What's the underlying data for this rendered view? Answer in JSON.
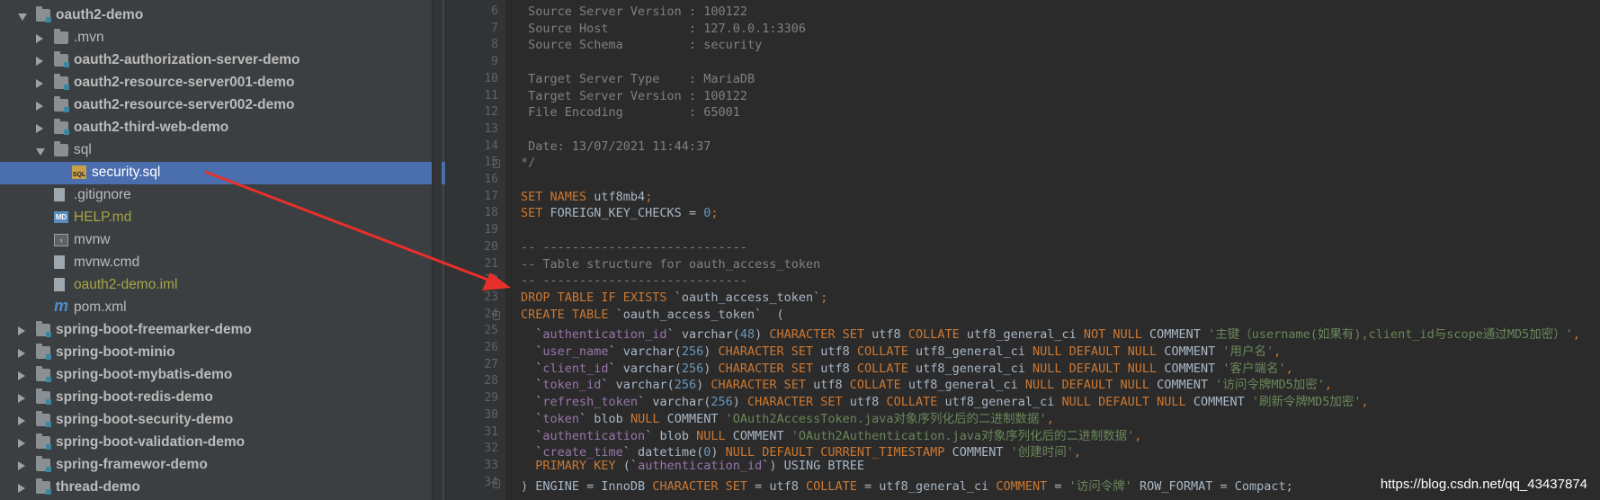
{
  "tree": {
    "items": [
      {
        "label": "oauth2-demo",
        "icon": "module-folder-icon",
        "arrow": "down",
        "bold": true,
        "indent": 0
      },
      {
        "label": ".mvn",
        "icon": "folder-icon",
        "arrow": "right",
        "bold": false,
        "indent": 1
      },
      {
        "label": "oauth2-authorization-server-demo",
        "icon": "module-folder-icon",
        "arrow": "right",
        "bold": true,
        "indent": 1
      },
      {
        "label": "oauth2-resource-server001-demo",
        "icon": "module-folder-icon",
        "arrow": "right",
        "bold": true,
        "indent": 1
      },
      {
        "label": "oauth2-resource-server002-demo",
        "icon": "module-folder-icon",
        "arrow": "right",
        "bold": true,
        "indent": 1
      },
      {
        "label": "oauth2-third-web-demo",
        "icon": "module-folder-icon",
        "arrow": "right",
        "bold": true,
        "indent": 1
      },
      {
        "label": "sql",
        "icon": "folder-icon",
        "arrow": "down",
        "bold": false,
        "indent": 1
      },
      {
        "label": "security.sql",
        "icon": "sql-file-icon",
        "arrow": "",
        "bold": false,
        "indent": 2,
        "selected": true
      },
      {
        "label": ".gitignore",
        "icon": "file-icon",
        "arrow": "",
        "bold": false,
        "indent": 1
      },
      {
        "label": "HELP.md",
        "icon": "markdown-file-icon",
        "arrow": "",
        "bold": false,
        "indent": 1,
        "color": "#a7a546"
      },
      {
        "label": "mvnw",
        "icon": "terminal-file-icon",
        "arrow": "",
        "bold": false,
        "indent": 1
      },
      {
        "label": "mvnw.cmd",
        "icon": "file-icon",
        "arrow": "",
        "bold": false,
        "indent": 1
      },
      {
        "label": "oauth2-demo.iml",
        "icon": "file-icon",
        "arrow": "",
        "bold": false,
        "indent": 1,
        "color": "#a7a546"
      },
      {
        "label": "pom.xml",
        "icon": "maven-icon",
        "arrow": "",
        "bold": false,
        "indent": 1
      },
      {
        "label": "spring-boot-freemarker-demo",
        "icon": "module-folder-icon",
        "arrow": "right",
        "bold": true,
        "indent": 0
      },
      {
        "label": "spring-boot-minio",
        "icon": "module-folder-icon",
        "arrow": "right",
        "bold": true,
        "indent": 0
      },
      {
        "label": "spring-boot-mybatis-demo",
        "icon": "module-folder-icon",
        "arrow": "right",
        "bold": true,
        "indent": 0
      },
      {
        "label": "spring-boot-redis-demo",
        "icon": "module-folder-icon",
        "arrow": "right",
        "bold": true,
        "indent": 0
      },
      {
        "label": "spring-boot-security-demo",
        "icon": "module-folder-icon",
        "arrow": "right",
        "bold": true,
        "indent": 0
      },
      {
        "label": "spring-boot-validation-demo",
        "icon": "module-folder-icon",
        "arrow": "right",
        "bold": true,
        "indent": 0
      },
      {
        "label": "spring-framewor-demo",
        "icon": "module-folder-icon",
        "arrow": "right",
        "bold": true,
        "indent": 0
      },
      {
        "label": "thread-demo",
        "icon": "module-folder-icon",
        "arrow": "right",
        "bold": true,
        "indent": 0
      }
    ]
  },
  "editor": {
    "lines": [
      {
        "n": "6",
        "parts": [
          [
            "cm",
            " Source Server Version : 100122"
          ]
        ]
      },
      {
        "n": "7",
        "parts": [
          [
            "cm",
            " Source Host           : 127.0.0.1:3306"
          ]
        ]
      },
      {
        "n": "8",
        "parts": [
          [
            "cm",
            " Source Schema         : security"
          ]
        ]
      },
      {
        "n": "9",
        "parts": []
      },
      {
        "n": "10",
        "parts": [
          [
            "cm",
            " Target Server Type    : MariaDB"
          ]
        ]
      },
      {
        "n": "11",
        "parts": [
          [
            "cm",
            " Target Server Version : 100122"
          ]
        ]
      },
      {
        "n": "12",
        "parts": [
          [
            "cm",
            " File Encoding         : 65001"
          ]
        ]
      },
      {
        "n": "13",
        "parts": []
      },
      {
        "n": "14",
        "parts": [
          [
            "cm",
            " Date: 13/07/2021 11:44:37"
          ]
        ]
      },
      {
        "n": "15",
        "parts": [
          [
            "cm",
            "*/"
          ]
        ],
        "fold": true
      },
      {
        "n": "16",
        "parts": []
      },
      {
        "n": "17",
        "parts": [
          [
            "kw",
            "SET NAMES "
          ],
          [
            "df",
            "utf8mb4"
          ],
          [
            "kw",
            ";"
          ]
        ]
      },
      {
        "n": "18",
        "parts": [
          [
            "kw",
            "SET "
          ],
          [
            "df",
            "FOREIGN_KEY_CHECKS = "
          ],
          [
            "nu",
            "0"
          ],
          [
            "kw",
            ";"
          ]
        ]
      },
      {
        "n": "19",
        "parts": []
      },
      {
        "n": "20",
        "parts": [
          [
            "cm",
            "-- ----------------------------"
          ]
        ]
      },
      {
        "n": "21",
        "parts": [
          [
            "cm",
            "-- Table structure for oauth_access_token"
          ]
        ]
      },
      {
        "n": "22",
        "parts": [
          [
            "cm",
            "-- ----------------------------"
          ]
        ]
      },
      {
        "n": "23",
        "parts": [
          [
            "kw",
            "DROP TABLE IF EXISTS "
          ],
          [
            "df",
            "`oauth_access_token`"
          ],
          [
            "kw",
            ";"
          ]
        ]
      },
      {
        "n": "24",
        "parts": [
          [
            "kw",
            "CREATE TABLE "
          ],
          [
            "df",
            "`oauth_access_token`  ("
          ]
        ],
        "fold": true
      },
      {
        "n": "25",
        "parts": [
          [
            "df",
            "  `"
          ],
          [
            "id",
            "authentication_id"
          ],
          [
            "df",
            "` varchar("
          ],
          [
            "nu",
            "48"
          ],
          [
            "df",
            ") "
          ],
          [
            "kw",
            "CHARACTER SET "
          ],
          [
            "df",
            "utf8 "
          ],
          [
            "kw",
            "COLLATE "
          ],
          [
            "df",
            "utf8_general_ci "
          ],
          [
            "kw",
            "NOT NULL "
          ],
          [
            "df",
            "COMMENT "
          ],
          [
            "st",
            "'主键（username(如果有),client_id与scope通过MD5加密）'"
          ],
          [
            "kw",
            ","
          ]
        ]
      },
      {
        "n": "26",
        "parts": [
          [
            "df",
            "  `"
          ],
          [
            "id",
            "user_name"
          ],
          [
            "df",
            "` varchar("
          ],
          [
            "nu",
            "256"
          ],
          [
            "df",
            ") "
          ],
          [
            "kw",
            "CHARACTER SET "
          ],
          [
            "df",
            "utf8 "
          ],
          [
            "kw",
            "COLLATE "
          ],
          [
            "df",
            "utf8_general_ci "
          ],
          [
            "kw",
            "NULL DEFAULT NULL "
          ],
          [
            "df",
            "COMMENT "
          ],
          [
            "st",
            "'用户名'"
          ],
          [
            "kw",
            ","
          ]
        ]
      },
      {
        "n": "27",
        "parts": [
          [
            "df",
            "  `"
          ],
          [
            "id",
            "client_id"
          ],
          [
            "df",
            "` varchar("
          ],
          [
            "nu",
            "256"
          ],
          [
            "df",
            ") "
          ],
          [
            "kw",
            "CHARACTER SET "
          ],
          [
            "df",
            "utf8 "
          ],
          [
            "kw",
            "COLLATE "
          ],
          [
            "df",
            "utf8_general_ci "
          ],
          [
            "kw",
            "NULL DEFAULT NULL "
          ],
          [
            "df",
            "COMMENT "
          ],
          [
            "st",
            "'客户端名'"
          ],
          [
            "kw",
            ","
          ]
        ]
      },
      {
        "n": "28",
        "parts": [
          [
            "df",
            "  `"
          ],
          [
            "id",
            "token_id"
          ],
          [
            "df",
            "` varchar("
          ],
          [
            "nu",
            "256"
          ],
          [
            "df",
            ") "
          ],
          [
            "kw",
            "CHARACTER SET "
          ],
          [
            "df",
            "utf8 "
          ],
          [
            "kw",
            "COLLATE "
          ],
          [
            "df",
            "utf8_general_ci "
          ],
          [
            "kw",
            "NULL DEFAULT NULL "
          ],
          [
            "df",
            "COMMENT "
          ],
          [
            "st",
            "'访问令牌MD5加密'"
          ],
          [
            "kw",
            ","
          ]
        ]
      },
      {
        "n": "29",
        "parts": [
          [
            "df",
            "  `"
          ],
          [
            "id",
            "refresh_token"
          ],
          [
            "df",
            "` varchar("
          ],
          [
            "nu",
            "256"
          ],
          [
            "df",
            ") "
          ],
          [
            "kw",
            "CHARACTER SET "
          ],
          [
            "df",
            "utf8 "
          ],
          [
            "kw",
            "COLLATE "
          ],
          [
            "df",
            "utf8_general_ci "
          ],
          [
            "kw",
            "NULL DEFAULT NULL "
          ],
          [
            "df",
            "COMMENT "
          ],
          [
            "st",
            "'刷新令牌MD5加密'"
          ],
          [
            "kw",
            ","
          ]
        ]
      },
      {
        "n": "30",
        "parts": [
          [
            "df",
            "  `"
          ],
          [
            "id",
            "token"
          ],
          [
            "df",
            "` blob "
          ],
          [
            "kw",
            "NULL "
          ],
          [
            "df",
            "COMMENT "
          ],
          [
            "st",
            "'OAuth2AccessToken.java对象序列化后的二进制数据'"
          ],
          [
            "kw",
            ","
          ]
        ]
      },
      {
        "n": "31",
        "parts": [
          [
            "df",
            "  `"
          ],
          [
            "id",
            "authentication"
          ],
          [
            "df",
            "` blob "
          ],
          [
            "kw",
            "NULL "
          ],
          [
            "df",
            "COMMENT "
          ],
          [
            "st",
            "'OAuth2Authentication.java对象序列化后的二进制数据'"
          ],
          [
            "kw",
            ","
          ]
        ]
      },
      {
        "n": "32",
        "parts": [
          [
            "df",
            "  `"
          ],
          [
            "id",
            "create_time"
          ],
          [
            "df",
            "` datetime("
          ],
          [
            "nu",
            "0"
          ],
          [
            "df",
            ") "
          ],
          [
            "kw",
            "NULL DEFAULT CURRENT_TIMESTAMP "
          ],
          [
            "df",
            "COMMENT "
          ],
          [
            "st",
            "'创建时间'"
          ],
          [
            "kw",
            ","
          ]
        ]
      },
      {
        "n": "33",
        "parts": [
          [
            "kw",
            "  PRIMARY KEY "
          ],
          [
            "df",
            "(`"
          ],
          [
            "id",
            "authentication_id"
          ],
          [
            "df",
            "`) USING BTREE"
          ]
        ]
      },
      {
        "n": "34",
        "parts": [
          [
            "df",
            ") ENGINE = InnoDB "
          ],
          [
            "kw",
            "CHARACTER SET "
          ],
          [
            "df",
            "= utf8 "
          ],
          [
            "kw",
            "COLLATE "
          ],
          [
            "df",
            "= utf8_general_ci "
          ],
          [
            "kw",
            "COMMENT "
          ],
          [
            "df",
            "= "
          ],
          [
            "st",
            "'访问令牌'"
          ],
          [
            "df",
            " ROW_FORMAT = Compact;"
          ]
        ],
        "fold": true
      }
    ]
  },
  "watermark": "https://blog.csdn.net/qq_43437874",
  "colors": {
    "selection": "#4b6eaf",
    "annotation_arrow": "#e8302a",
    "keyword": "#cc7832",
    "string": "#6a8759",
    "number": "#6897bb",
    "comment": "#808080"
  }
}
